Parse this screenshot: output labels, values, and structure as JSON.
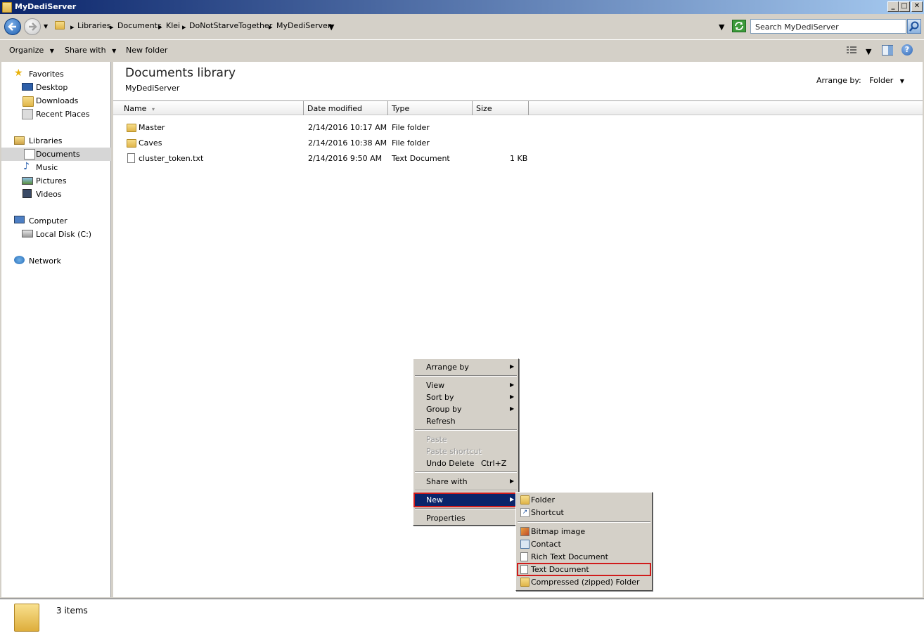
{
  "window": {
    "title": "MyDediServer"
  },
  "address": {
    "crumbs": [
      "Libraries",
      "Documents",
      "Klei",
      "DoNotStarveTogether",
      "MyDediServer"
    ],
    "search_placeholder": "Search MyDediServer"
  },
  "toolbar": {
    "organize": "Organize",
    "share_with": "Share with",
    "new_folder": "New folder"
  },
  "nav": {
    "favorites": "Favorites",
    "desktop": "Desktop",
    "downloads": "Downloads",
    "recent_places": "Recent Places",
    "libraries": "Libraries",
    "documents": "Documents",
    "music": "Music",
    "pictures": "Pictures",
    "videos": "Videos",
    "computer": "Computer",
    "local_disk": "Local Disk (C:)",
    "network": "Network"
  },
  "content": {
    "title": "Documents library",
    "subtitle": "MyDediServer",
    "arrange_label": "Arrange by:",
    "arrange_value": "Folder",
    "columns": {
      "name": "Name",
      "date": "Date modified",
      "type": "Type",
      "size": "Size"
    },
    "files": [
      {
        "name": "Master",
        "date": "2/14/2016 10:17 AM",
        "type": "File folder",
        "size": ""
      },
      {
        "name": "Caves",
        "date": "2/14/2016 10:38 AM",
        "type": "File folder",
        "size": ""
      },
      {
        "name": "cluster_token.txt",
        "date": "2/14/2016 9:50 AM",
        "type": "Text Document",
        "size": "1 KB"
      }
    ]
  },
  "status": {
    "count": "3 items"
  },
  "context_menu": {
    "arrange_by": "Arrange by",
    "view": "View",
    "sort_by": "Sort by",
    "group_by": "Group by",
    "refresh": "Refresh",
    "paste": "Paste",
    "paste_shortcut": "Paste shortcut",
    "undo_delete": "Undo Delete",
    "undo_shortcut": "Ctrl+Z",
    "share_with": "Share with",
    "new": "New",
    "properties": "Properties"
  },
  "new_submenu": {
    "folder": "Folder",
    "shortcut": "Shortcut",
    "bitmap": "Bitmap image",
    "contact": "Contact",
    "rich_text": "Rich Text Document",
    "text_document": "Text Document",
    "zip_folder": "Compressed (zipped) Folder"
  }
}
